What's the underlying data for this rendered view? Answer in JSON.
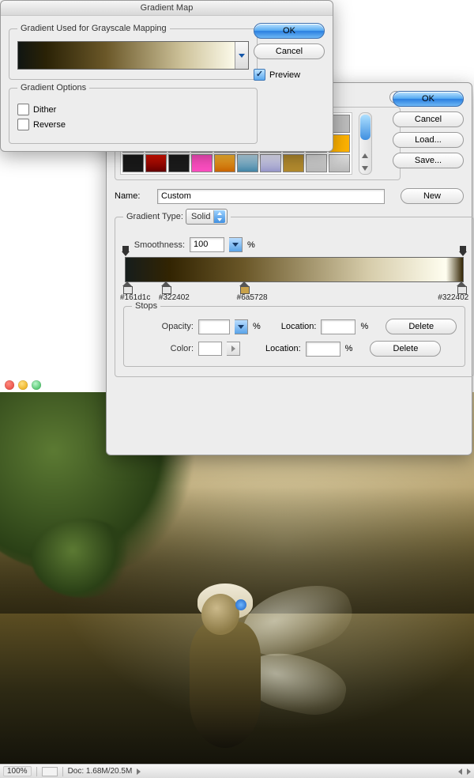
{
  "gradientMap": {
    "title": "Gradient Map",
    "groupGradient": "Gradient Used for Grayscale Mapping",
    "groupOptions": "Gradient Options",
    "dither": "Dither",
    "reverse": "Reverse",
    "ok": "OK",
    "cancel": "Cancel",
    "preview": "Preview"
  },
  "editor": {
    "ok": "OK",
    "cancel": "Cancel",
    "load": "Load...",
    "save": "Save...",
    "nameLabel": "Name:",
    "nameValue": "Custom",
    "newBtn": "New",
    "typeGroup": "Gradient Type:",
    "typeValue": "Solid",
    "smoothLabel": "Smoothness:",
    "smoothValue": "100",
    "percent": "%",
    "stopsGroup": "Stops",
    "opacityLabel": "Opacity:",
    "colorLabel": "Color:",
    "locationLabel": "Location:",
    "delete": "Delete",
    "stopHexes": {
      "s1": "#161d1c",
      "s2": "#322402",
      "s3": "#6a5728",
      "s4": "#322402"
    }
  },
  "status": {
    "zoom": "100%",
    "doc": "Doc: 1.68M/20.5M"
  },
  "swatchColors": [
    "linear-gradient(90deg,#f39,#ff0,#0f0,#0ff,#33f,#f0f)",
    "linear-gradient(90deg,#0ff,#f0f,#ff0)",
    "#c0c0c0",
    "#ff7b00",
    "#000",
    "#8b0000",
    "linear-gradient(90deg,#f00,#ff0,#0f0,#0ff,#00f,#f0f,#f00)",
    "repeating-linear-gradient(45deg,#000 0 3px,#fff 3px 6px)",
    "linear-gradient(45deg,#a5f,#fae)",
    "#bdbdbd",
    "#c8a200",
    "#ff8a2a",
    "linear-gradient(#444,#000)",
    "linear-gradient(#b97,#7a4)",
    "linear-gradient(#eee,#bbb)",
    "linear-gradient(#9fc,#3a7)",
    "linear-gradient(45deg,#52f,#c4f)",
    "#7fbf3f",
    "#e2df4a",
    "#ffb300",
    "#191919",
    "linear-gradient(#d10,#600)",
    "#1b1b1b",
    "#ff4fc3",
    "linear-gradient(#fb3,#c60)",
    "linear-gradient(#bde,#48a)",
    "linear-gradient(#eef,#99c)",
    "#b38b2e"
  ]
}
